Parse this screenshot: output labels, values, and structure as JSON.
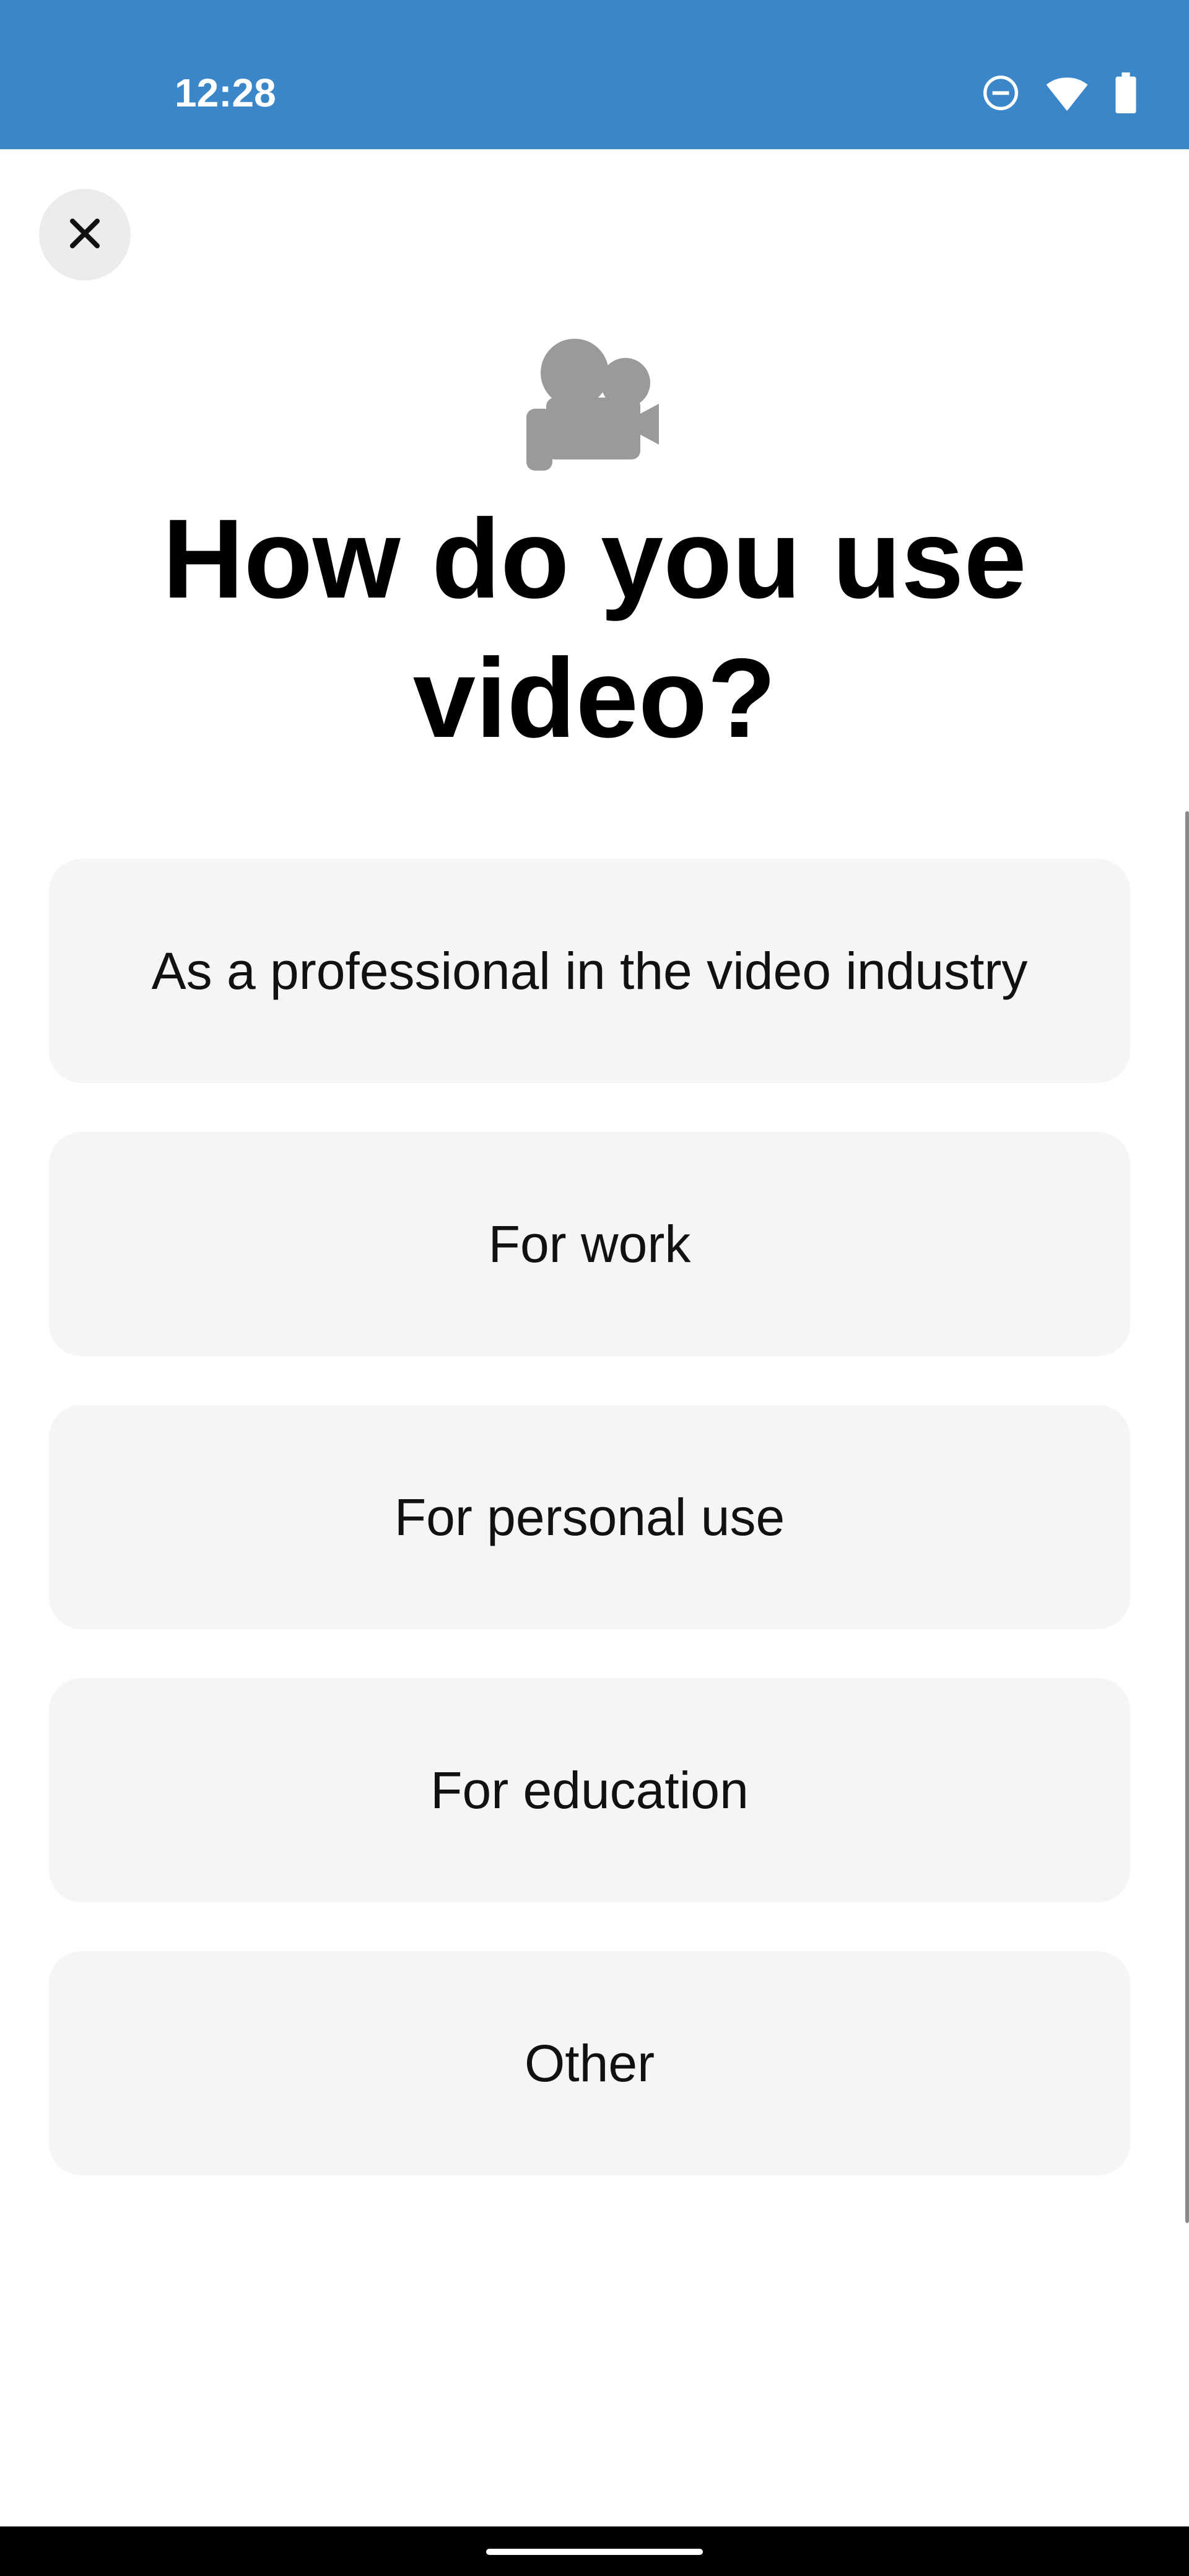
{
  "status_bar": {
    "time": "12:28",
    "icons": [
      "do-not-disturb-icon",
      "wifi-icon",
      "battery-icon"
    ],
    "background": "#3a86c8"
  },
  "close": {
    "icon": "close-icon"
  },
  "hero": {
    "icon": "video-camera-icon",
    "color": "#9a9a9a"
  },
  "title": "How do you use video?",
  "options": [
    "As a professional in the video industry",
    "For work",
    "For personal use",
    "For education",
    "Other"
  ]
}
